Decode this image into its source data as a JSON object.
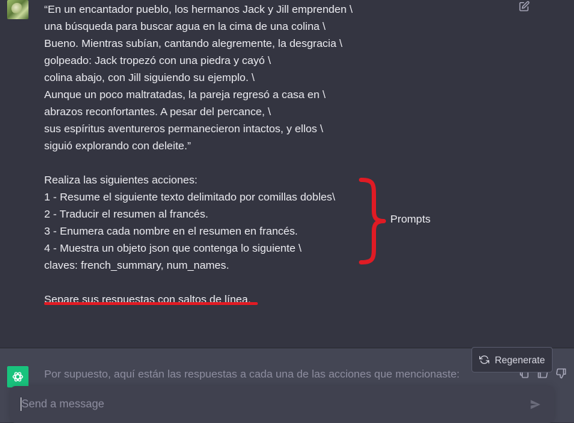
{
  "user_message": {
    "lines": [
      "“En un encantador pueblo, los hermanos Jack y Jill emprenden \\",
      "una búsqueda para buscar agua en la cima de una colina \\",
      "Bueno. Mientras subían, cantando alegremente, la desgracia \\",
      "golpeado: Jack tropezó con una piedra y cayó \\",
      "colina abajo, con Jill siguiendo su ejemplo. \\",
      "Aunque un poco maltratadas, la pareja regresó a casa en \\",
      "abrazos reconfortantes. A pesar del percance, \\",
      "sus espíritus aventureros permanecieron intactos, y ellos \\",
      "siguió explorando con deleite.”",
      "",
      "Realiza las siguientes acciones:",
      "1 - Resume el siguiente texto delimitado por comillas dobles\\",
      "2 - Traducir el resumen al francés.",
      "3 - Enumera cada nombre en el resumen en francés.",
      "4 - Muestra un objeto json que contenga lo siguiente \\",
      "claves: french_summary, num_names.",
      "",
      "Separe sus respuestas con saltos de línea."
    ]
  },
  "annotation": {
    "label": "Prompts",
    "color": "#e01b24"
  },
  "assistant_message": {
    "text": "Por supuesto, aquí están las respuestas a cada una de las acciones que mencionaste:"
  },
  "regenerate_label": "Regenerate",
  "composer": {
    "placeholder": "Send a message"
  },
  "icons": {
    "edit": "edit-icon",
    "regenerate": "refresh-icon",
    "copy": "copy-icon",
    "thumbs_up": "thumbs-up-icon",
    "thumbs_down": "thumbs-down-icon",
    "send": "send-icon",
    "assistant_logo": "openai-logo-icon"
  },
  "colors": {
    "background": "#343541",
    "assistant_bg": "#444654",
    "accent_green": "#19c37d",
    "annotation_red": "#e01b24"
  }
}
